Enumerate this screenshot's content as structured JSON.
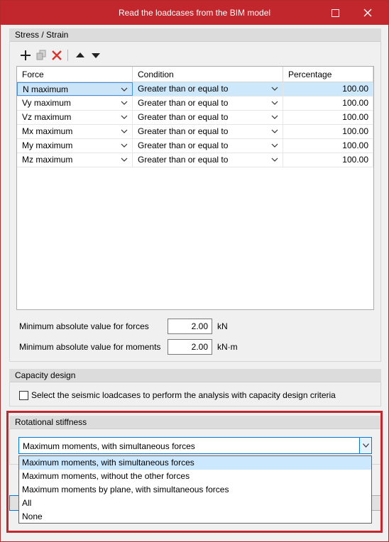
{
  "window": {
    "title": "Read the loadcases from the BIM model"
  },
  "stress_strain": {
    "header": "Stress / Strain",
    "toolbar": {
      "icons": [
        "add-icon",
        "copy-icon",
        "delete-icon",
        "move-up-icon",
        "move-down-icon"
      ]
    },
    "columns": [
      "Force",
      "Condition",
      "Percentage"
    ],
    "rows": [
      {
        "force": "N maximum",
        "condition": "Greater than or equal to",
        "percentage": "100.00"
      },
      {
        "force": "Vy maximum",
        "condition": "Greater than or equal to",
        "percentage": "100.00"
      },
      {
        "force": "Vz maximum",
        "condition": "Greater than or equal to",
        "percentage": "100.00"
      },
      {
        "force": "Mx maximum",
        "condition": "Greater than or equal to",
        "percentage": "100.00"
      },
      {
        "force": "My maximum",
        "condition": "Greater than or equal to",
        "percentage": "100.00"
      },
      {
        "force": "Mz maximum",
        "condition": "Greater than or equal to",
        "percentage": "100.00"
      }
    ],
    "min_forces": {
      "label": "Minimum absolute value for forces",
      "value": "2.00",
      "unit": "kN"
    },
    "min_moments": {
      "label": "Minimum absolute value for moments",
      "value": "2.00",
      "unit": "kN·m"
    }
  },
  "capacity_design": {
    "header": "Capacity design",
    "checkbox_label": "Select the seismic loadcases to perform the analysis with capacity design criteria",
    "checked": false
  },
  "rotational_stiffness": {
    "header": "Rotational stiffness",
    "selected": "Maximum moments, with simultaneous forces",
    "options": [
      "Maximum moments, with simultaneous forces",
      "Maximum moments, without the other forces",
      "Maximum moments by plane, with simultaneous forces",
      "All",
      "None"
    ]
  },
  "colors": {
    "titlebar": "#c1272d",
    "selection": "#cce8ff",
    "accent": "#0078d7",
    "highlight_frame": "#c1272d"
  }
}
